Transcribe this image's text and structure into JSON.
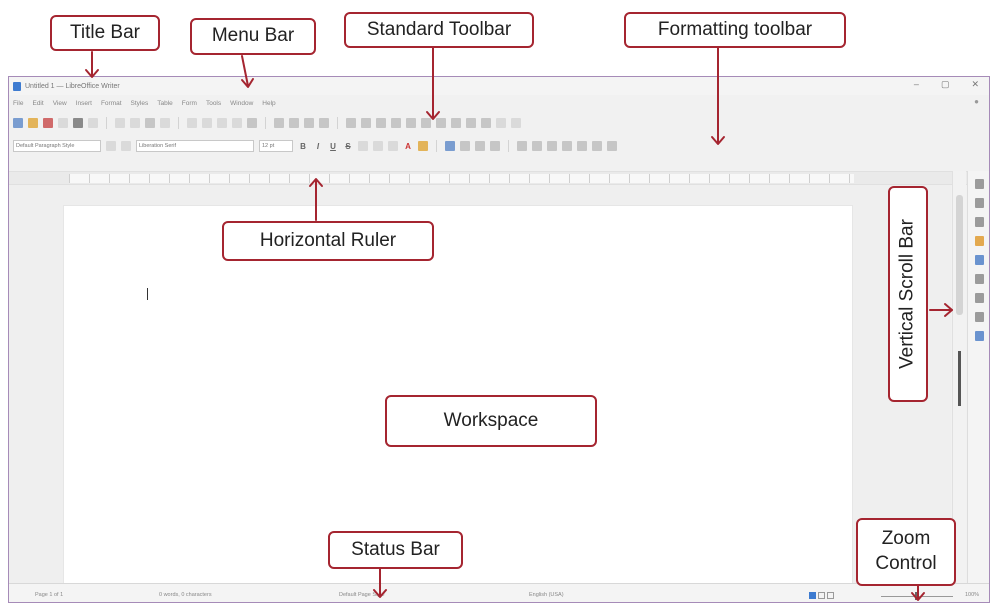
{
  "callouts": {
    "title_bar": "Title Bar",
    "menu_bar": "Menu Bar",
    "standard_toolbar": "Standard Toolbar",
    "formatting_toolbar": "Formatting toolbar",
    "horizontal_ruler": "Horizontal Ruler",
    "vertical_scroll_bar": "Vertical Scroll Bar",
    "workspace": "Workspace",
    "status_bar": "Status Bar",
    "zoom_control_line1": "Zoom",
    "zoom_control_line2": "Control"
  },
  "window": {
    "title": "Untitled 1 — LibreOffice Writer",
    "controls": [
      "–",
      "▢",
      "✕"
    ]
  },
  "menu": [
    "File",
    "Edit",
    "View",
    "Insert",
    "Format",
    "Styles",
    "Table",
    "Form",
    "Tools",
    "Window",
    "Help"
  ],
  "formatting": {
    "paragraph_style": "Default Paragraph Style",
    "font_name": "Liberation Serif",
    "font_size": "12 pt"
  },
  "status": {
    "page": "Page 1 of 1",
    "words": "0 words, 0 characters",
    "page_style": "Default Page Style",
    "language": "English (USA)",
    "zoom": "100%"
  },
  "colors": {
    "callout_border": "#a52530",
    "window_border": "#a68bb8"
  }
}
